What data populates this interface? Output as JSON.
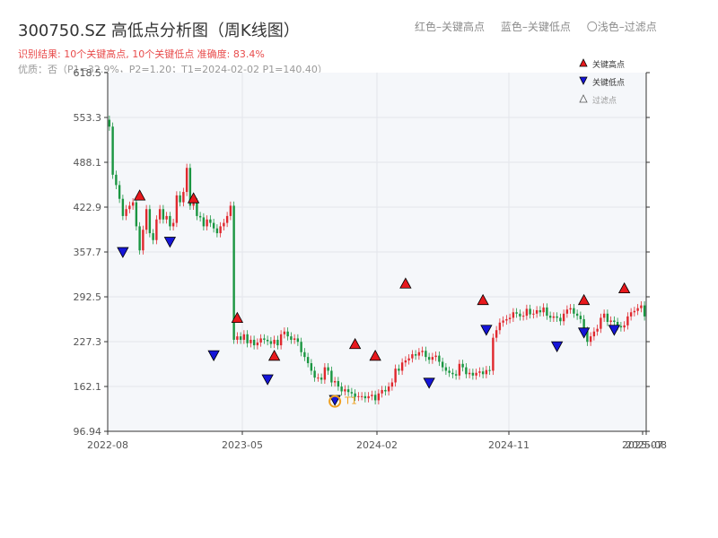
{
  "title": "300750.SZ 高低点分析图（周K线图）",
  "legend_text": {
    "red": "红色–关键高点",
    "blue": "蓝色–关键低点",
    "light": "〇浅色–过滤点"
  },
  "subtitle_result": "识别结果: 10个关键高点, 10个关键低点  准确度: 83.4%",
  "subtitle_pattern": "优质：否（P1=32.9%，P2=1.20；T1=2024-02-02 P1=140.40）",
  "colors": {
    "up": "#e0282e",
    "down": "#1a9641",
    "high_marker": "#e8191d",
    "low_marker": "#1515d8",
    "plot_bg": "#f5f7fa",
    "grid": "#e3e6eb",
    "annotation": "#f0a020"
  },
  "chart_data": {
    "type": "candlestick",
    "timeframe": "weekly",
    "x_ticks": [
      "2022-08",
      "2023-05",
      "2024-02",
      "2024-11",
      "2025-07",
      "2025-08"
    ],
    "y_ticks": [
      96.94,
      162.1,
      227.3,
      292.5,
      357.7,
      422.9,
      488.1,
      553.3,
      618.5
    ],
    "ylim": [
      96.94,
      618.5
    ],
    "grid": true,
    "legend_position": "top-right",
    "legend": [
      {
        "label": "关键高点",
        "marker": "triangle-up",
        "color": "#e8191d"
      },
      {
        "label": "关键低点",
        "marker": "triangle-down",
        "color": "#1515d8"
      },
      {
        "label": "过滤点",
        "marker": "triangle-outline",
        "color": "#999999"
      }
    ],
    "close": [
      540,
      470,
      455,
      435,
      410,
      420,
      425,
      430,
      395,
      360,
      390,
      420,
      385,
      375,
      405,
      420,
      405,
      410,
      395,
      400,
      440,
      430,
      445,
      480,
      425,
      430,
      410,
      408,
      395,
      405,
      400,
      392,
      385,
      395,
      400,
      410,
      425,
      230,
      235,
      230,
      238,
      225,
      230,
      222,
      226,
      232,
      230,
      228,
      224,
      230,
      222,
      238,
      242,
      235,
      230,
      232,
      227,
      212,
      205,
      196,
      185,
      175,
      175,
      172,
      190,
      185,
      168,
      170,
      162,
      155,
      158,
      154,
      152,
      147,
      148,
      148,
      145,
      148,
      150,
      142,
      152,
      157,
      155,
      162,
      168,
      188,
      185,
      197,
      200,
      203,
      209,
      207,
      212,
      214,
      205,
      201,
      205,
      207,
      198,
      190,
      185,
      182,
      180,
      178,
      195,
      190,
      180,
      182,
      178,
      182,
      184,
      180,
      186,
      185,
      233,
      244,
      255,
      258,
      260,
      262,
      270,
      268,
      264,
      265,
      275,
      267,
      268,
      273,
      270,
      277,
      265,
      262,
      264,
      262,
      257,
      268,
      274,
      276,
      268,
      265,
      260,
      243,
      227,
      235,
      242,
      246,
      262,
      268,
      256,
      258,
      256,
      250,
      248,
      251,
      264,
      270,
      272,
      276,
      280,
      264
    ],
    "key_highs": [
      {
        "index": 9,
        "price": 428
      },
      {
        "index": 25,
        "price": 424
      },
      {
        "index": 38,
        "price": 250
      },
      {
        "index": 49,
        "price": 195
      },
      {
        "index": 73,
        "price": 212
      },
      {
        "index": 79,
        "price": 195
      },
      {
        "index": 88,
        "price": 300
      },
      {
        "index": 111,
        "price": 276
      },
      {
        "index": 141,
        "price": 276
      },
      {
        "index": 153,
        "price": 293
      }
    ],
    "key_lows": [
      {
        "index": 4,
        "price": 355
      },
      {
        "index": 18,
        "price": 370
      },
      {
        "index": 31,
        "price": 205
      },
      {
        "index": 47,
        "price": 170
      },
      {
        "index": 67,
        "price": 140
      },
      {
        "index": 95,
        "price": 165
      },
      {
        "index": 112,
        "price": 242
      },
      {
        "index": 133,
        "price": 218
      },
      {
        "index": 141,
        "price": 238
      },
      {
        "index": 150,
        "price": 242
      }
    ],
    "annotation": {
      "label": "T1",
      "date": "2024-02-02",
      "price": 140.4
    }
  }
}
